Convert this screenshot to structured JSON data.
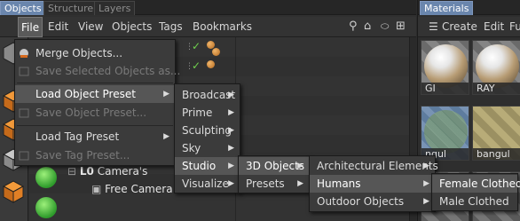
{
  "tabs": [
    {
      "label": "Objects",
      "active": true
    },
    {
      "label": "Structure",
      "active": false
    },
    {
      "label": "Layers",
      "active": false
    }
  ],
  "menubar": [
    "File",
    "Edit",
    "View",
    "Objects",
    "Tags",
    "Bookmarks"
  ],
  "tree": {
    "camera_group": "Camera's",
    "free_camera": "Free Camera"
  },
  "materials": {
    "tab": "Materials",
    "menu": [
      "Create",
      "Edit",
      "Fu"
    ],
    "swatches": [
      {
        "label": "GI"
      },
      {
        "label": "RAY"
      },
      {
        "label": "ngul"
      },
      {
        "label": "bangul"
      }
    ]
  },
  "file_menu": {
    "items": [
      {
        "label": "Merge Objects...",
        "enabled": true
      },
      {
        "label": "Save Selected Objects as...",
        "enabled": false
      },
      {
        "label": "Load Object Preset",
        "enabled": true,
        "submenu": true,
        "highlighted": true
      },
      {
        "label": "Save Object Preset...",
        "enabled": false
      },
      {
        "label": "Load Tag Preset",
        "enabled": true,
        "submenu": true
      },
      {
        "label": "Save Tag Preset...",
        "enabled": false
      }
    ]
  },
  "preset_menu": {
    "items": [
      {
        "label": "Broadcast"
      },
      {
        "label": "Prime"
      },
      {
        "label": "Sculpting"
      },
      {
        "label": "Sky"
      },
      {
        "label": "Studio",
        "highlighted": true
      },
      {
        "label": "Visualize"
      }
    ]
  },
  "studio_menu": {
    "items": [
      {
        "label": "3D Objects",
        "highlighted": true
      },
      {
        "label": "Presets"
      }
    ]
  },
  "objects3d_menu": {
    "items": [
      {
        "label": "Architectural Elements"
      },
      {
        "label": "Humans",
        "highlighted": true
      },
      {
        "label": "Outdoor Objects"
      }
    ]
  },
  "humans_menu": {
    "items": [
      {
        "label": "Female Clothed",
        "highlighted": true
      },
      {
        "label": "Male Clothed"
      }
    ]
  },
  "colors": {
    "accent_tab": "#6a86ad",
    "menu_bg": "#3b3b3b",
    "menu_highlight": "#565656",
    "check_green": "#6fd04e"
  }
}
